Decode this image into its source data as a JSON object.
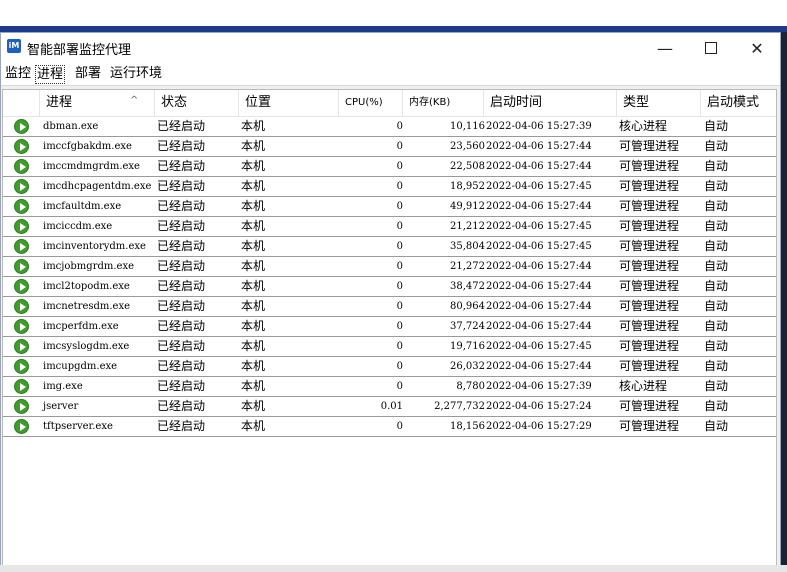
{
  "window": {
    "title": "智能部署监控代理",
    "icon": "app-logo-icon"
  },
  "tabs": [
    {
      "label": "监控",
      "active": false
    },
    {
      "label": "进程",
      "active": true
    },
    {
      "label": "部署",
      "active": false
    },
    {
      "label": "运行环境",
      "active": false
    }
  ],
  "columns": [
    {
      "key": "name",
      "label": "进程"
    },
    {
      "key": "status",
      "label": "状态"
    },
    {
      "key": "location",
      "label": "位置"
    },
    {
      "key": "cpu",
      "label": "CPU(%)"
    },
    {
      "key": "memory",
      "label": "内存(KB)"
    },
    {
      "key": "start_time",
      "label": "启动时间"
    },
    {
      "key": "type",
      "label": "类型"
    },
    {
      "key": "start_mode",
      "label": "启动模式"
    }
  ],
  "rows": [
    {
      "name": "dbman.exe",
      "status": "已经启动",
      "location": "本机",
      "cpu": "0",
      "memory": "10,116",
      "start_time": "2022-04-06 15:27:39",
      "type": "核心进程",
      "start_mode": "自动"
    },
    {
      "name": "imccfgbakdm.exe",
      "status": "已经启动",
      "location": "本机",
      "cpu": "0",
      "memory": "23,560",
      "start_time": "2022-04-06 15:27:44",
      "type": "可管理进程",
      "start_mode": "自动"
    },
    {
      "name": "imccmdmgrdm.exe",
      "status": "已经启动",
      "location": "本机",
      "cpu": "0",
      "memory": "22,508",
      "start_time": "2022-04-06 15:27:44",
      "type": "可管理进程",
      "start_mode": "自动"
    },
    {
      "name": "imcdhcpagentdm.exe",
      "status": "已经启动",
      "location": "本机",
      "cpu": "0",
      "memory": "18,952",
      "start_time": "2022-04-06 15:27:45",
      "type": "可管理进程",
      "start_mode": "自动"
    },
    {
      "name": "imcfaultdm.exe",
      "status": "已经启动",
      "location": "本机",
      "cpu": "0",
      "memory": "49,912",
      "start_time": "2022-04-06 15:27:44",
      "type": "可管理进程",
      "start_mode": "自动"
    },
    {
      "name": "imciccdm.exe",
      "status": "已经启动",
      "location": "本机",
      "cpu": "0",
      "memory": "21,212",
      "start_time": "2022-04-06 15:27:45",
      "type": "可管理进程",
      "start_mode": "自动"
    },
    {
      "name": "imcinventorydm.exe",
      "status": "已经启动",
      "location": "本机",
      "cpu": "0",
      "memory": "35,804",
      "start_time": "2022-04-06 15:27:45",
      "type": "可管理进程",
      "start_mode": "自动"
    },
    {
      "name": "imcjobmgrdm.exe",
      "status": "已经启动",
      "location": "本机",
      "cpu": "0",
      "memory": "21,272",
      "start_time": "2022-04-06 15:27:44",
      "type": "可管理进程",
      "start_mode": "自动"
    },
    {
      "name": "imcl2topodm.exe",
      "status": "已经启动",
      "location": "本机",
      "cpu": "0",
      "memory": "38,472",
      "start_time": "2022-04-06 15:27:44",
      "type": "可管理进程",
      "start_mode": "自动"
    },
    {
      "name": "imcnetresdm.exe",
      "status": "已经启动",
      "location": "本机",
      "cpu": "0",
      "memory": "80,964",
      "start_time": "2022-04-06 15:27:44",
      "type": "可管理进程",
      "start_mode": "自动"
    },
    {
      "name": "imcperfdm.exe",
      "status": "已经启动",
      "location": "本机",
      "cpu": "0",
      "memory": "37,724",
      "start_time": "2022-04-06 15:27:44",
      "type": "可管理进程",
      "start_mode": "自动"
    },
    {
      "name": "imcsyslogdm.exe",
      "status": "已经启动",
      "location": "本机",
      "cpu": "0",
      "memory": "19,716",
      "start_time": "2022-04-06 15:27:45",
      "type": "可管理进程",
      "start_mode": "自动"
    },
    {
      "name": "imcupgdm.exe",
      "status": "已经启动",
      "location": "本机",
      "cpu": "0",
      "memory": "26,032",
      "start_time": "2022-04-06 15:27:44",
      "type": "可管理进程",
      "start_mode": "自动"
    },
    {
      "name": "img.exe",
      "status": "已经启动",
      "location": "本机",
      "cpu": "0",
      "memory": "8,780",
      "start_time": "2022-04-06 15:27:39",
      "type": "核心进程",
      "start_mode": "自动"
    },
    {
      "name": "jserver",
      "status": "已经启动",
      "location": "本机",
      "cpu": "0.01",
      "memory": "2,277,732",
      "start_time": "2022-04-06 15:27:24",
      "type": "可管理进程",
      "start_mode": "自动"
    },
    {
      "name": "tftpserver.exe",
      "status": "已经启动",
      "location": "本机",
      "cpu": "0",
      "memory": "18,156",
      "start_time": "2022-04-06 15:27:29",
      "type": "可管理进程",
      "start_mode": "自动"
    }
  ],
  "colors": {
    "running": "#3f9b2c",
    "accent": "#1f5fbf"
  },
  "icons": {
    "row": "running-status-icon",
    "sort": "sort-ascending-icon"
  }
}
